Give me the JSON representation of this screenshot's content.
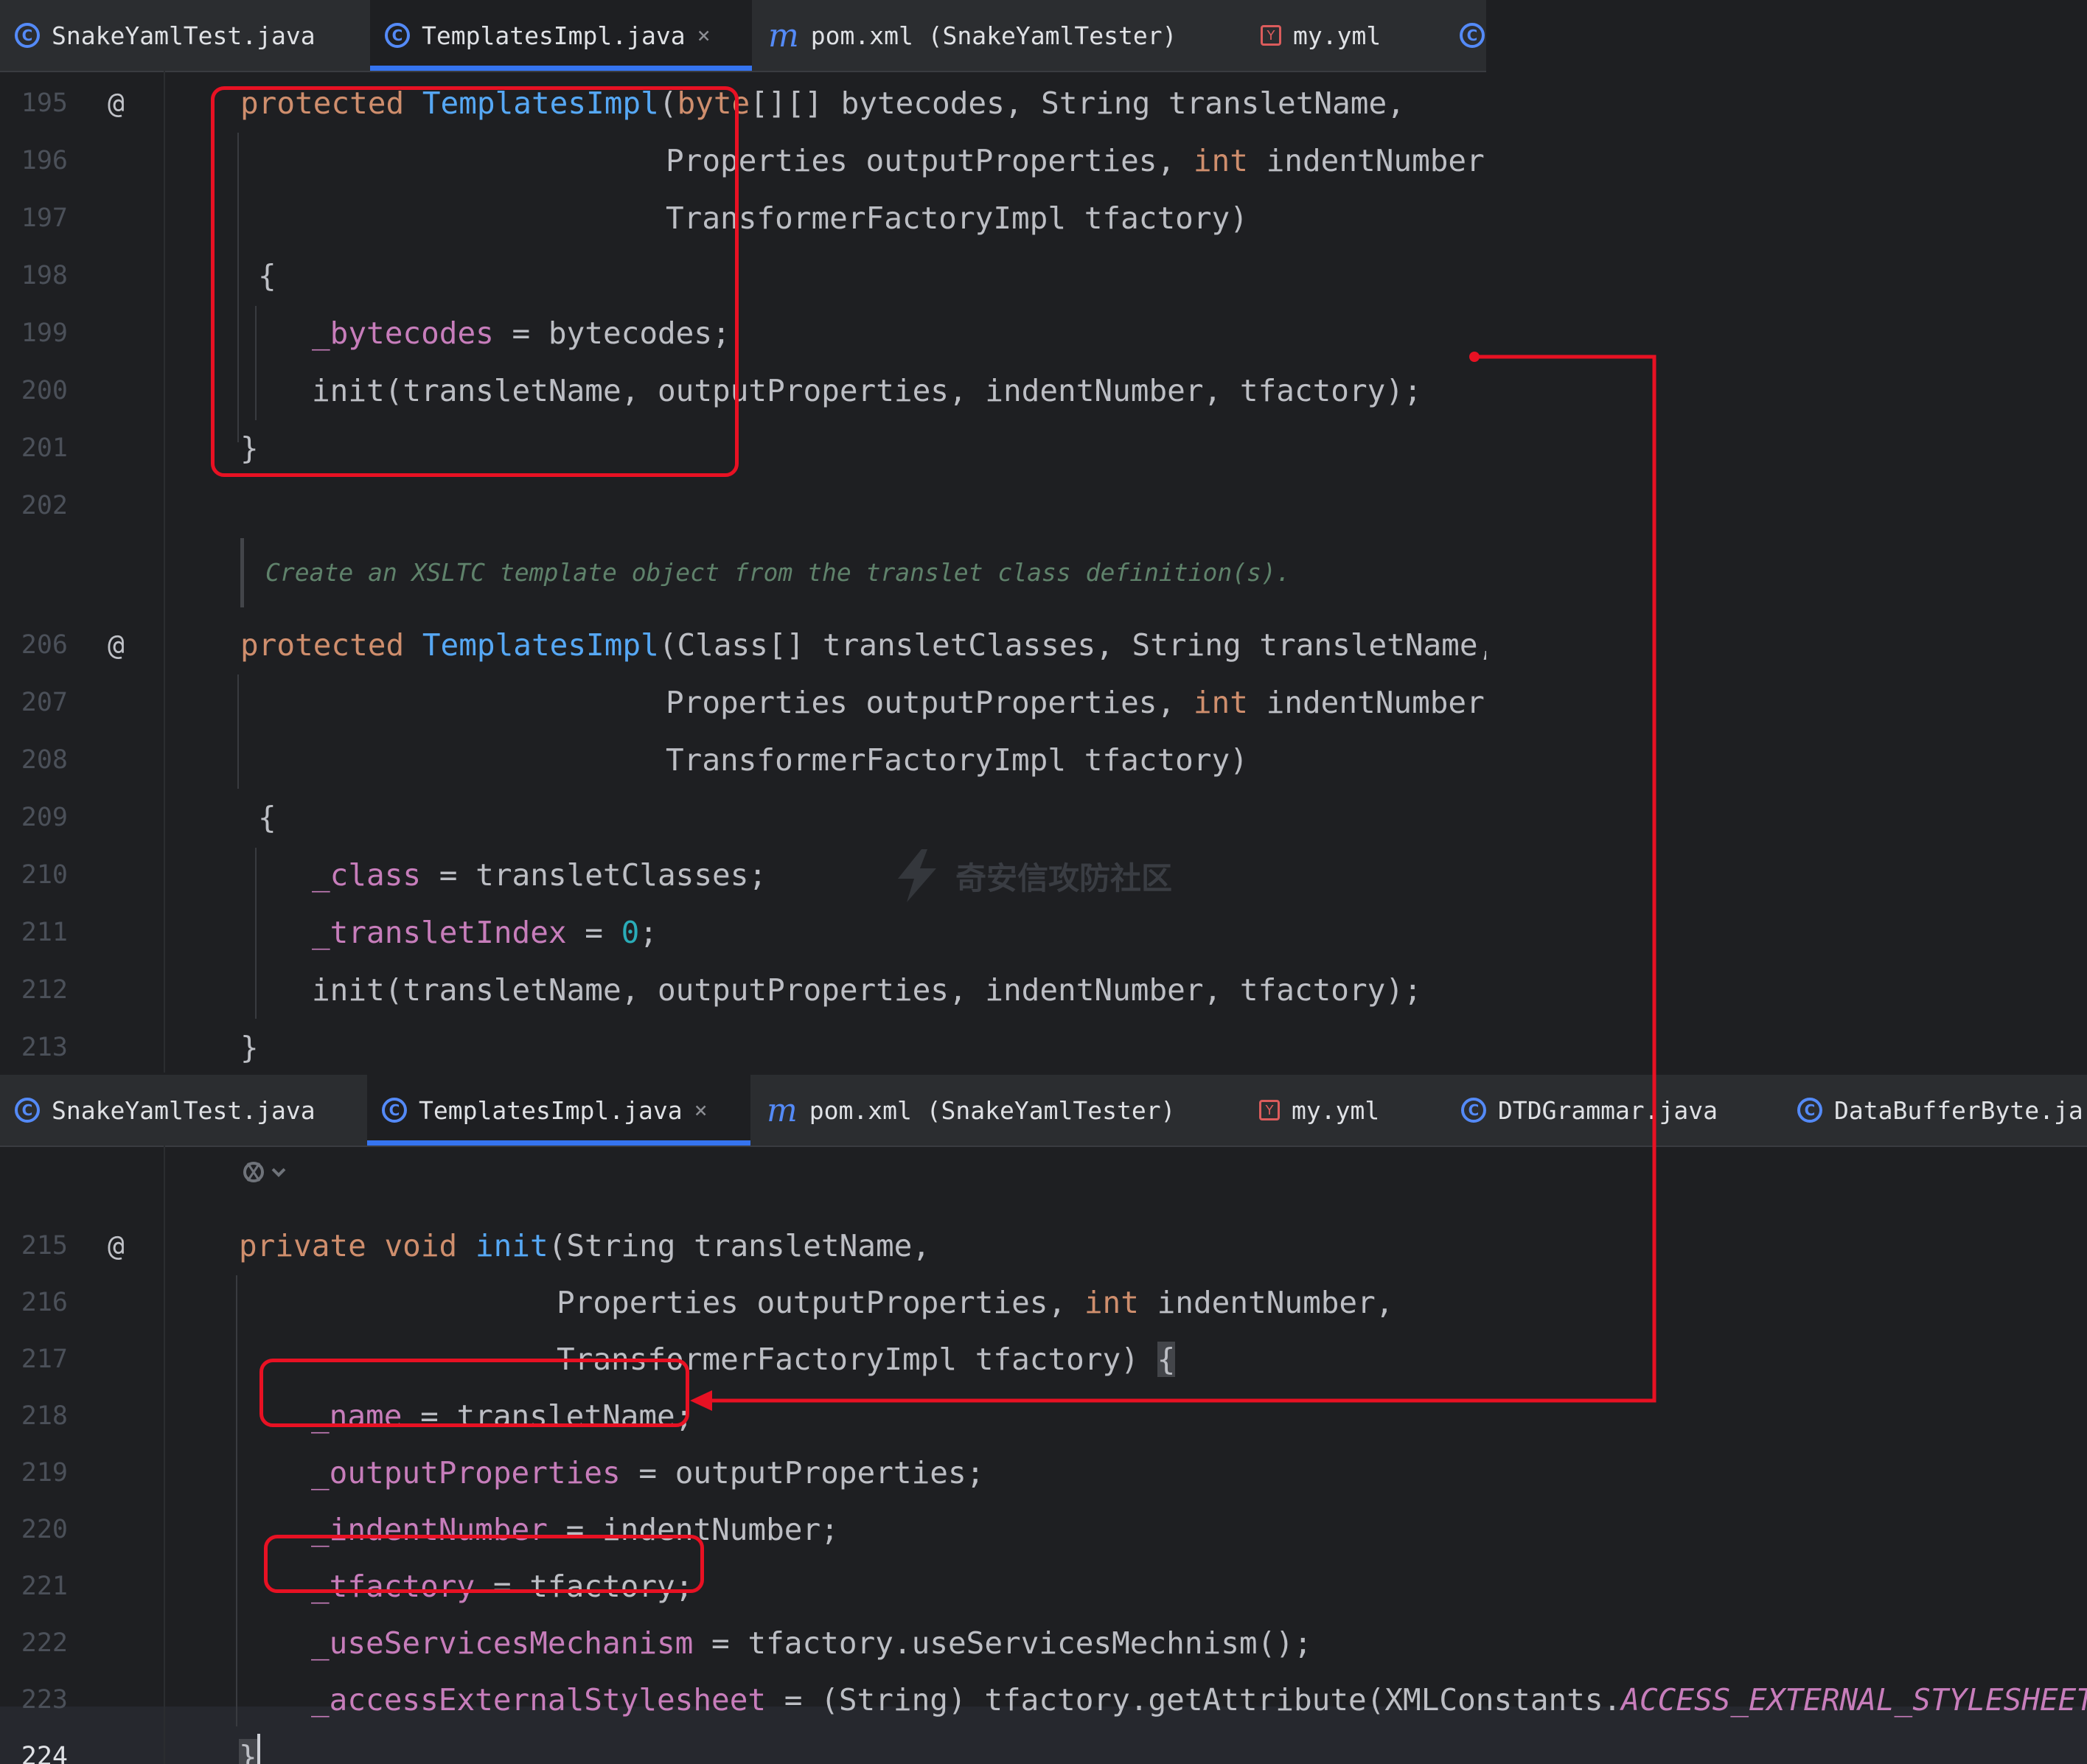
{
  "tabs_top": [
    {
      "label": "SnakeYamlTest.java",
      "icon": "java-class-icon"
    },
    {
      "label": "TemplatesImpl.java",
      "icon": "java-class-icon",
      "active": true
    },
    {
      "label": "pom.xml (SnakeYamlTester)",
      "icon": "maven-icon"
    },
    {
      "label": "my.yml",
      "icon": "yaml-icon"
    },
    {
      "label": "",
      "icon": "java-class-icon"
    }
  ],
  "tabs_bottom": [
    {
      "label": "SnakeYamlTest.java",
      "icon": "java-class-icon"
    },
    {
      "label": "TemplatesImpl.java",
      "icon": "java-class-icon",
      "active": true
    },
    {
      "label": "pom.xml (SnakeYamlTester)",
      "icon": "maven-icon"
    },
    {
      "label": "my.yml",
      "icon": "yaml-icon"
    },
    {
      "label": "DTDGrammar.java",
      "icon": "java-class-icon"
    },
    {
      "label": "DataBufferByte.ja",
      "icon": "java-class-icon"
    }
  ],
  "tab_close_glyph": "×",
  "override_marker": "@",
  "line_numbers_top": [
    "195",
    "196",
    "197",
    "198",
    "199",
    "200",
    "201",
    "202",
    "206",
    "207",
    "208",
    "209",
    "210",
    "211",
    "212",
    "213"
  ],
  "line_numbers_bottom": [
    "215",
    "216",
    "217",
    "218",
    "219",
    "220",
    "221",
    "222",
    "223",
    "224"
  ],
  "code_top": {
    "l195": {
      "kw": "protected",
      "fn": "TemplatesImpl",
      "p1": "(",
      "kw2": "byte",
      "rest": "[][] bytecodes, String transletName,"
    },
    "l196": {
      "t1": "Properties outputProperties, ",
      "kw": "int",
      "t2": " indentNumber,"
    },
    "l197": "TransformerFactoryImpl tfactory)",
    "l198": "{",
    "l199": {
      "fd": "_bytecodes",
      "rest": " = bytecodes;"
    },
    "l200": "init(transletName, outputProperties, indentNumber, tfactory);",
    "l201": "}",
    "doc": "Create an XSLTC template object from the translet class definition(s).",
    "l206": {
      "kw": "protected",
      "fn": "TemplatesImpl",
      "rest": "(Class[] transletClasses, String transletName,"
    },
    "l207": {
      "t1": "Properties outputProperties, ",
      "kw": "int",
      "t2": " indentNumber,"
    },
    "l208": "TransformerFactoryImpl tfactory)",
    "l209": "{",
    "l210": {
      "fd": "_class",
      "rest": " = transletClasses;"
    },
    "l211": {
      "fd": "_transletIndex",
      "mid": " = ",
      "num": "0",
      "end": ";"
    },
    "l212": "init(transletName, outputProperties, indentNumber, tfactory);",
    "l213": "}"
  },
  "code_bottom": {
    "l215": {
      "kw": "private void",
      "fn": "init",
      "rest": "(String transletName,"
    },
    "l216": {
      "t1": "Properties outputProperties, ",
      "kw": "int",
      "t2": " indentNumber,"
    },
    "l217": {
      "t": "TransformerFactoryImpl tfactory) ",
      "brace": "{"
    },
    "l218": {
      "fd": "_name",
      "rest": " = transletName;"
    },
    "l219": {
      "fd": "_outputProperties",
      "rest": " = outputProperties;"
    },
    "l220": {
      "fd": "_indentNumber",
      "rest": " = indentNumber;"
    },
    "l221": {
      "fd": "_tfactory",
      "rest": " = tfactory;"
    },
    "l222": {
      "fd": "_useServicesMechanism",
      "rest": " = tfactory.useServicesMechnism();"
    },
    "l223": {
      "fd": "_accessExternalStylesheet",
      "mid": " = (String) tfactory.getAttribute(XMLConstants.",
      "cst": "ACCESS_EXTERNAL_STYLESHEET",
      "end": ");"
    },
    "l224": "}"
  },
  "watermark": "奇安信攻防社区",
  "colors": {
    "annotation": "#e81123",
    "keyword": "#cf8e6d",
    "function": "#56a8f5",
    "field": "#c77dbb",
    "number": "#2aacb8",
    "doc_comment": "#5f826b",
    "tab_accent": "#3574f0"
  }
}
